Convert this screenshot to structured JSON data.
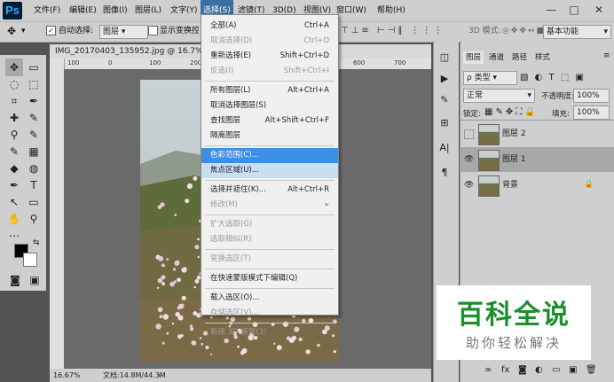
{
  "app": {
    "logo": "Ps"
  },
  "menubar": {
    "items": [
      "文件(F)",
      "编辑(E)",
      "图像(I)",
      "图层(L)",
      "文字(Y)",
      "选择(S)",
      "滤镜(T)",
      "3D(D)",
      "视图(V)",
      "窗口(W)",
      "帮助(H)"
    ],
    "active": "选择(S)",
    "window_controls": [
      "—",
      "□",
      "✕"
    ]
  },
  "options": {
    "auto_select_label": "自动选择:",
    "auto_select_value": "图层",
    "show_transform_label": "显示变换控件",
    "mode_3d_label": "3D 模式:",
    "workspace": "基本功能"
  },
  "document": {
    "tab_title": "IMG_20170403_135952.jpg @ 16.7% (图层",
    "ruler_ticks": [
      "100",
      "0",
      "100",
      "200",
      "300",
      "400",
      "500",
      "600",
      "700"
    ],
    "zoom": "16.67%",
    "doc_size": "文档:14.8M/44.3M"
  },
  "select_menu": {
    "items": [
      {
        "label": "全部(A)",
        "shortcut": "Ctrl+A",
        "state": "normal"
      },
      {
        "label": "取消选择(D)",
        "shortcut": "Ctrl+D",
        "state": "disabled"
      },
      {
        "label": "重新选择(E)",
        "shortcut": "Shift+Ctrl+D",
        "state": "normal"
      },
      {
        "label": "反选(I)",
        "shortcut": "Shift+Ctrl+I",
        "state": "disabled"
      },
      {
        "sep": true
      },
      {
        "label": "所有图层(L)",
        "shortcut": "Alt+Ctrl+A",
        "state": "normal"
      },
      {
        "label": "取消选择图层(S)",
        "shortcut": "",
        "state": "normal"
      },
      {
        "label": "查找图层",
        "shortcut": "Alt+Shift+Ctrl+F",
        "state": "normal"
      },
      {
        "label": "隔离图层",
        "shortcut": "",
        "state": "normal"
      },
      {
        "sep": true
      },
      {
        "label": "色彩范围(C)...",
        "shortcut": "",
        "state": "highlight"
      },
      {
        "label": "焦点区域(U)...",
        "shortcut": "",
        "state": "hover"
      },
      {
        "sep": true
      },
      {
        "label": "选择并遮住(K)...",
        "shortcut": "Alt+Ctrl+R",
        "state": "normal"
      },
      {
        "label": "修改(M)",
        "shortcut": "▸",
        "state": "disabled"
      },
      {
        "sep": true
      },
      {
        "label": "扩大选取(G)",
        "shortcut": "",
        "state": "disabled"
      },
      {
        "label": "选取相似(R)",
        "shortcut": "",
        "state": "disabled"
      },
      {
        "sep": true
      },
      {
        "label": "变换选区(T)",
        "shortcut": "",
        "state": "disabled"
      },
      {
        "sep": true
      },
      {
        "label": "在快速蒙版模式下编辑(Q)",
        "shortcut": "",
        "state": "normal"
      },
      {
        "sep": true
      },
      {
        "label": "载入选区(O)...",
        "shortcut": "",
        "state": "normal"
      },
      {
        "label": "存储选区(V)...",
        "shortcut": "",
        "state": "disabled"
      },
      {
        "sep": true
      },
      {
        "label": "新建 3D 模型(3)",
        "shortcut": "",
        "state": "disabled"
      }
    ]
  },
  "layers_panel": {
    "tabs": [
      "图层",
      "通道",
      "路径",
      "样式"
    ],
    "filter_label": "ρ 类型",
    "blend_mode": "正常",
    "opacity_label": "不透明度:",
    "opacity_value": "100%",
    "lock_label": "锁定:",
    "fill_label": "填充:",
    "fill_value": "100%",
    "layers": [
      {
        "name": "图层 2",
        "visible": false,
        "selected": false,
        "locked": false
      },
      {
        "name": "图层 1",
        "visible": true,
        "selected": true,
        "locked": false
      },
      {
        "name": "背景",
        "visible": true,
        "selected": false,
        "locked": true
      }
    ],
    "footer_icons": [
      "link-icon",
      "fx-icon",
      "mask-icon",
      "adjustment-icon",
      "folder-icon",
      "new-layer-icon",
      "trash-icon"
    ]
  },
  "watermark": {
    "main": "百科全说",
    "sub": "助你轻松解决"
  },
  "colors": {
    "accent": "#3d8ee6",
    "watermark_green": "#1a8f2b"
  }
}
